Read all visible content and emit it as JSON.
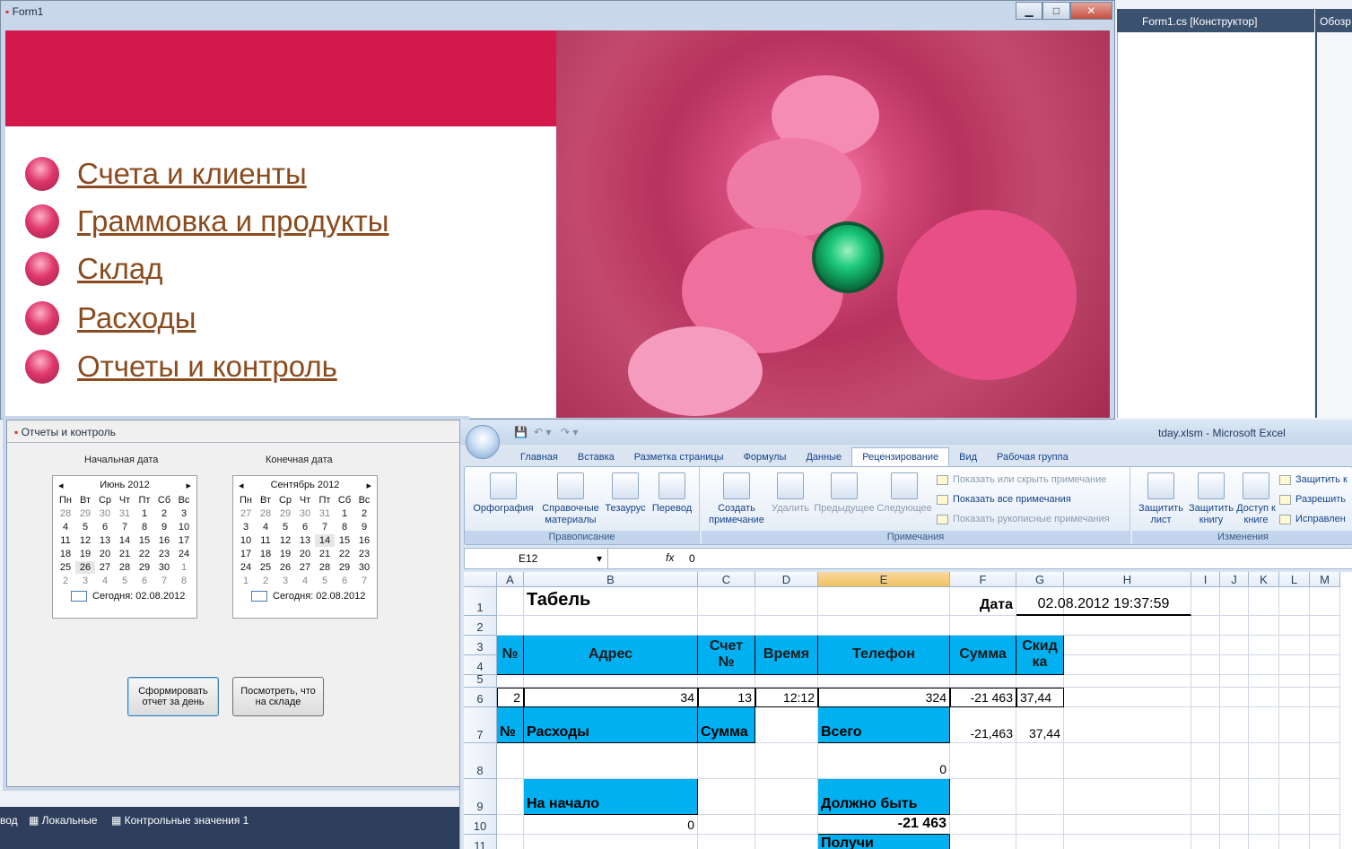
{
  "vs": {
    "doc_tab": "Form1.cs [Конструктор]",
    "side_tab": "Обозр",
    "bottom_items": [
      "вод",
      "Локальные",
      "Контрольные значения 1"
    ]
  },
  "form1": {
    "title": "Form1",
    "menu": [
      "Счета и клиенты",
      "Граммовка и продукты",
      "Склад",
      "Расходы",
      "Отчеты и контроль"
    ]
  },
  "reports": {
    "title": "Отчеты и контроль",
    "start_label": "Начальная дата",
    "end_label": "Конечная дата",
    "cal1": {
      "month": "Июнь 2012",
      "days_header": [
        "Пн",
        "Вт",
        "Ср",
        "Чт",
        "Пт",
        "Сб",
        "Вс"
      ],
      "rows": [
        [
          "28",
          "29",
          "30",
          "31",
          "1",
          "2",
          "3"
        ],
        [
          "4",
          "5",
          "6",
          "7",
          "8",
          "9",
          "10"
        ],
        [
          "11",
          "12",
          "13",
          "14",
          "15",
          "16",
          "17"
        ],
        [
          "18",
          "19",
          "20",
          "21",
          "22",
          "23",
          "24"
        ],
        [
          "25",
          "26",
          "27",
          "28",
          "29",
          "30",
          "1"
        ],
        [
          "2",
          "3",
          "4",
          "5",
          "6",
          "7",
          "8"
        ]
      ],
      "today": "Сегодня: 02.08.2012"
    },
    "cal2": {
      "month": "Сентябрь 2012",
      "days_header": [
        "Пн",
        "Вт",
        "Ср",
        "Чт",
        "Пт",
        "Сб",
        "Вс"
      ],
      "rows": [
        [
          "27",
          "28",
          "29",
          "30",
          "31",
          "1",
          "2"
        ],
        [
          "3",
          "4",
          "5",
          "6",
          "7",
          "8",
          "9"
        ],
        [
          "10",
          "11",
          "12",
          "13",
          "14",
          "15",
          "16"
        ],
        [
          "17",
          "18",
          "19",
          "20",
          "21",
          "22",
          "23"
        ],
        [
          "24",
          "25",
          "26",
          "27",
          "28",
          "29",
          "30"
        ],
        [
          "1",
          "2",
          "3",
          "4",
          "5",
          "6",
          "7"
        ]
      ],
      "today": "Сегодня: 02.08.2012"
    },
    "btn_report": "Сформировать отчет за день",
    "btn_stock": "Посмотреть, что на складе"
  },
  "excel": {
    "title": "tday.xlsm - Microsoft Excel",
    "tabs": [
      "Главная",
      "Вставка",
      "Разметка страницы",
      "Формулы",
      "Данные",
      "Рецензирование",
      "Вид",
      "Рабочая группа"
    ],
    "ribbon": {
      "spelling": "Орфография",
      "reference": "Справочные материалы",
      "thesaurus": "Тезаурус",
      "translate": "Перевод",
      "group_proofing": "Правописание",
      "new_comment": "Создать примечание",
      "delete": "Удалить",
      "previous": "Предыдущее",
      "next": "Следующее",
      "show_hide": "Показать или скрыть примечание",
      "show_all": "Показать все примечания",
      "show_ink": "Показать рукописные примечания",
      "group_comments": "Примечания",
      "protect_sheet": "Защитить лист",
      "protect_book": "Защитить книгу",
      "share_book": "Доступ к книге",
      "protect_share": "Защитить к",
      "allow": "Разрешить",
      "track": "Исправлен",
      "group_changes": "Изменения"
    },
    "namebox": "E12",
    "formula": "0",
    "columns": [
      "A",
      "B",
      "C",
      "D",
      "E",
      "F",
      "G",
      "H",
      "I",
      "J",
      "K",
      "L",
      "M"
    ],
    "rows": [
      "1",
      "2",
      "3",
      "4",
      "5",
      "6",
      "7",
      "8",
      "9",
      "10",
      "11"
    ],
    "cells": {
      "title": "Табель",
      "date_label": "Дата",
      "date_value": "02.08.2012 19:37:59",
      "h_no": "№",
      "h_addr": "Адрес",
      "h_check": "Счет №",
      "h_time": "Время",
      "h_phone": "Телефон",
      "h_sum": "Сумма",
      "h_disc": "Скид ка",
      "r6_a": "2",
      "r6_b": "34",
      "r6_c": "13",
      "r6_d": "12:12",
      "r6_e": "324",
      "r6_f": "-21 463",
      "r6_g": "37,44",
      "r7_a": "№",
      "r7_b": "Расходы",
      "r7_c": "Сумма",
      "r7_e": "Всего",
      "r7_f": "-21,463",
      "r7_g": "37,44",
      "r8_e": "0",
      "r9_b": "На начало",
      "r9_e": "Должно быть",
      "r10_b": "0",
      "r10_e": "-21 463",
      "r11_e": "Получи"
    }
  }
}
